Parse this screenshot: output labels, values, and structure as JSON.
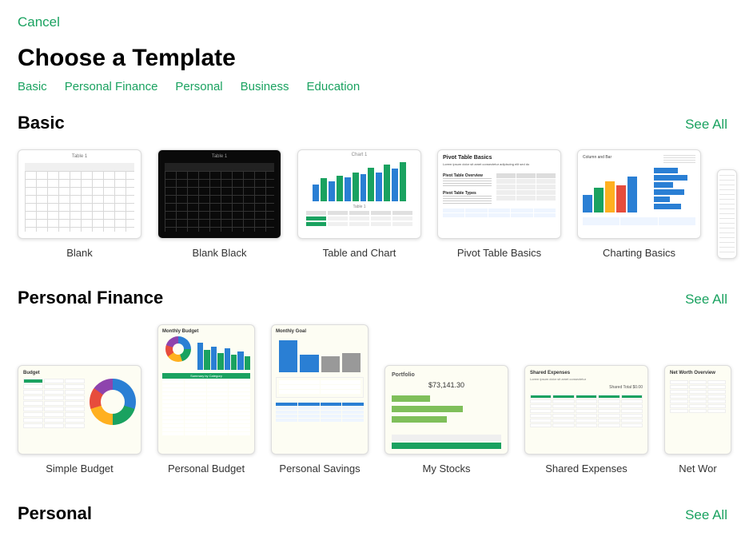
{
  "header": {
    "cancel": "Cancel",
    "title": "Choose a Template"
  },
  "categories": [
    "Basic",
    "Personal Finance",
    "Personal",
    "Business",
    "Education"
  ],
  "sections": {
    "basic": {
      "title": "Basic",
      "see_all": "See All",
      "items": [
        "Blank",
        "Blank Black",
        "Table and Chart",
        "Pivot Table Basics",
        "Charting Basics"
      ]
    },
    "personal_finance": {
      "title": "Personal Finance",
      "see_all": "See All",
      "items": [
        "Simple Budget",
        "Personal Budget",
        "Personal Savings",
        "My Stocks",
        "Shared Expenses",
        "Net Worth Overview"
      ]
    },
    "personal": {
      "title": "Personal",
      "see_all": "See All"
    }
  },
  "thumbs": {
    "blank": {
      "sheet": "Table 1"
    },
    "black": {
      "sheet": "Table 1"
    },
    "tc": {
      "chart_label": "Chart 1",
      "table_label": "Table 1"
    },
    "pivot": {
      "title": "Pivot Table Basics",
      "label1": "Pivot Table Overview",
      "label2": "Pivot Table Types"
    },
    "charting": {
      "lead": "Column and Bar"
    },
    "simple_budget": {
      "title": "Budget"
    },
    "personal_budget": {
      "title": "Monthly Budget",
      "mid": "Summary by Category"
    },
    "personal_savings": {
      "title": "Monthly Goal"
    },
    "stocks": {
      "title": "Portfolio",
      "amount": "$73,141.30"
    },
    "shared": {
      "title": "Shared Expenses"
    },
    "networth": {
      "title": "Net Worth Overview"
    }
  }
}
